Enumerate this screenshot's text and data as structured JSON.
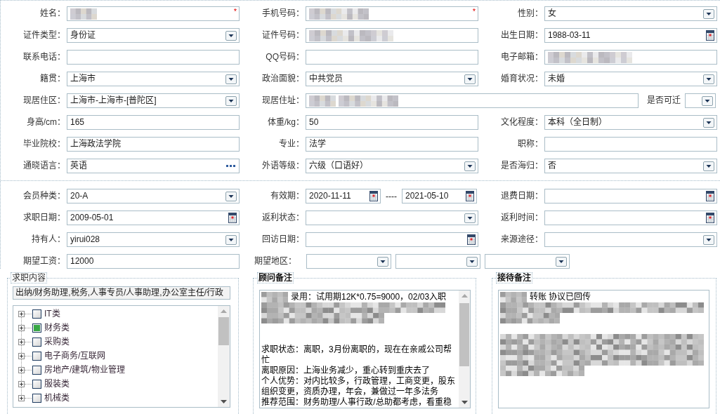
{
  "personal": {
    "rows": [
      {
        "fields": [
          {
            "label": "姓名：",
            "kind": "text",
            "redacted": [
              {
                "kind": "short"
              }
            ],
            "marker": "*"
          },
          {
            "label": "手机号码：",
            "kind": "text",
            "redacted": [
              {
                "kind": "medium"
              }
            ],
            "marker": "*"
          },
          {
            "label": "性别：",
            "kind": "select",
            "value": "女"
          }
        ]
      },
      {
        "fields": [
          {
            "label": "证件类型：",
            "kind": "select",
            "value": "身份证"
          },
          {
            "label": "证件号码：",
            "kind": "text",
            "redacted": [
              {
                "kind": "long"
              }
            ]
          },
          {
            "label": "出生日期：",
            "kind": "date",
            "value": "1988-03-11"
          }
        ]
      },
      {
        "fields": [
          {
            "label": "联系电话：",
            "kind": "text"
          },
          {
            "label": "QQ号码：",
            "kind": "text"
          },
          {
            "label": "电子邮箱：",
            "kind": "text",
            "redacted": [
              {
                "kind": "long"
              }
            ]
          }
        ]
      },
      {
        "fields": [
          {
            "label": "籍贯：",
            "kind": "select",
            "value": "上海市"
          },
          {
            "label": "政治面貌：",
            "kind": "select",
            "value": "中共党员"
          },
          {
            "label": "婚育状况：",
            "kind": "select",
            "value": "未婚"
          }
        ]
      },
      {
        "fields": [
          {
            "label": "现居住区：",
            "kind": "select",
            "value": "上海市-上海市-[普陀区]"
          },
          {
            "label": "现居住址：",
            "kind": "wide_text",
            "redacted": [
              {
                "kind": "short"
              },
              {
                "kind": "medium"
              }
            ]
          },
          {
            "label": "是否可迁",
            "kind": "compact_select"
          }
        ]
      },
      {
        "fields": [
          {
            "label": "身高/cm：",
            "kind": "text",
            "value": "165"
          },
          {
            "label": "体重/kg：",
            "kind": "text",
            "value": "50"
          },
          {
            "label": "文化程度：",
            "kind": "select",
            "value": "本科（全日制）"
          }
        ]
      },
      {
        "fields": [
          {
            "label": "毕业院校：",
            "kind": "text",
            "value": "上海政法学院"
          },
          {
            "label": "专业：",
            "kind": "text",
            "value": "法学"
          },
          {
            "label": "职称：",
            "kind": "text"
          }
        ]
      },
      {
        "fields": [
          {
            "label": "通晓语言：",
            "kind": "picker",
            "value": "英语"
          },
          {
            "label": "外语等级：",
            "kind": "select",
            "value": "六级（口语好）"
          },
          {
            "label": "是否海归：",
            "kind": "select",
            "value": "否"
          }
        ]
      }
    ]
  },
  "membership": {
    "rows": [
      {
        "fields": [
          {
            "label": "会员种类：",
            "kind": "select",
            "value": "20-A"
          },
          {
            "label": "有效期：",
            "kind": "date_range",
            "from": "2020-11-11",
            "separator": "----",
            "to": "2021-05-10"
          },
          {
            "label": "退费日期：",
            "kind": "date"
          }
        ]
      },
      {
        "fields": [
          {
            "label": "求职日期：",
            "kind": "date",
            "value": "2009-05-01"
          },
          {
            "label": "返利状态：",
            "kind": "select"
          },
          {
            "label": "返利时间：",
            "kind": "date"
          }
        ]
      },
      {
        "fields": [
          {
            "label": "持有人：",
            "kind": "select",
            "value": "yirui028"
          },
          {
            "label": "回访日期：",
            "kind": "date"
          },
          {
            "label": "来源途径：",
            "kind": "select"
          }
        ]
      },
      {
        "fields": [
          {
            "label": "期望工资：",
            "kind": "text",
            "value": "12000"
          },
          {
            "label": "期望地区：",
            "kind": "multi_select",
            "selects": [
              {
                "kind": "select"
              },
              {
                "kind": "select"
              },
              {
                "kind": "select"
              }
            ]
          }
        ]
      }
    ]
  },
  "job_content": {
    "legend": "求职内容",
    "summary": "出纳/财务助理,税务,人事专员/人事助理,办公室主任/行政",
    "tree": [
      {
        "label": "IT类",
        "checked": false,
        "expanded": false
      },
      {
        "label": "财务类",
        "checked": true,
        "expanded": false
      },
      {
        "label": "采购类",
        "checked": false,
        "expanded": false
      },
      {
        "label": "电子商务/互联网",
        "checked": false,
        "expanded": false
      },
      {
        "label": "房地产/建筑/物业管理",
        "checked": false,
        "expanded": false
      },
      {
        "label": "服装类",
        "checked": false,
        "expanded": false
      },
      {
        "label": "机械类",
        "checked": false,
        "expanded": false
      }
    ]
  },
  "advisor_notes": {
    "legend": "顾问备注",
    "lines": [
      {
        "kind": "text",
        "redacted": [
          {
            "kind": "short"
          }
        ],
        "text": "录用：试用期12K*0.75=9000，02/03入职"
      },
      {
        "kind": "mosaic_full"
      },
      {
        "kind": "mosaic_wide"
      },
      {
        "kind": "blank"
      },
      {
        "kind": "blank"
      },
      {
        "kind": "text",
        "text": "求职状态：离职，3月份离职的，现在在亲戚公司帮忙"
      },
      {
        "kind": "text",
        "text": "离职原因：上海业务减少，重心转到重庆去了"
      },
      {
        "kind": "text",
        "text": "个人优势：对内比较多，行政管理，工商变更，股东组织变更，资质办理，年会，兼做过一年多法务"
      },
      {
        "kind": "text",
        "text": "推荐范围：财务助理/人事行政/总助都考虑，看重稳"
      }
    ]
  },
  "reception_notes": {
    "legend": "接待备注",
    "lines": [
      {
        "kind": "text",
        "redacted": [
          {
            "kind": "short"
          }
        ],
        "text": "转账 协议已回传"
      },
      {
        "kind": "mosaic_full"
      },
      {
        "kind": "mosaic_medium"
      },
      {
        "kind": "blank"
      },
      {
        "kind": "mosaic_full"
      },
      {
        "kind": "mosaic_full"
      },
      {
        "kind": "mosaic_full"
      },
      {
        "kind": "mosaic_long"
      }
    ]
  }
}
